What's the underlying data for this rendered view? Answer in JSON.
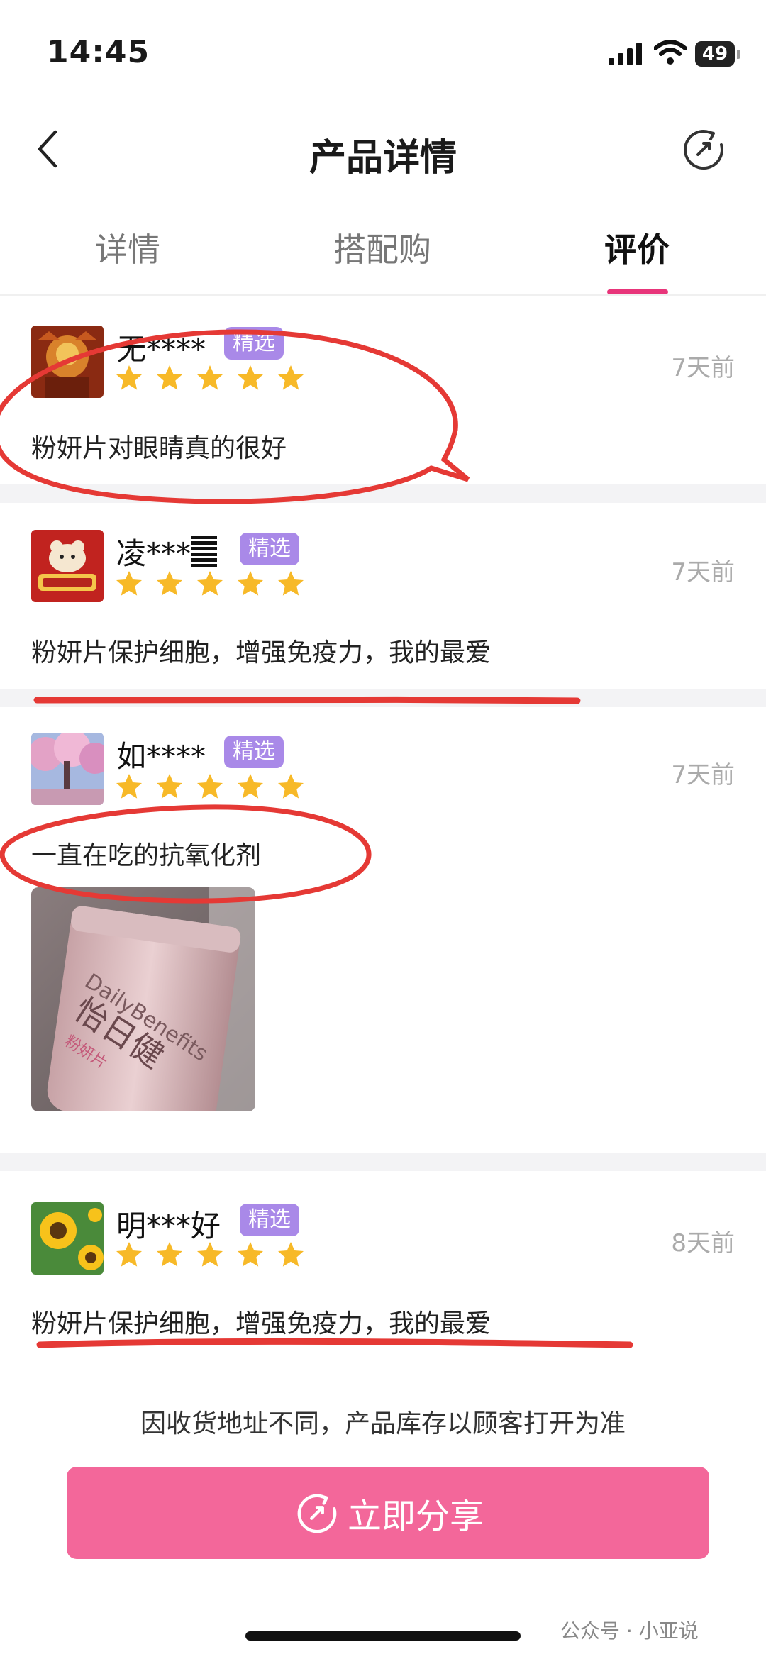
{
  "status_bar": {
    "time": "14:45",
    "battery": "49"
  },
  "nav": {
    "title": "产品详情"
  },
  "tabs": [
    {
      "label": "详情",
      "active": false
    },
    {
      "label": "搭配购",
      "active": false
    },
    {
      "label": "评价",
      "active": true
    }
  ],
  "reviews": [
    {
      "user": "无****",
      "badge": "精选",
      "rating": 5,
      "date": "7天前",
      "text": "粉妍片对眼睛真的很好"
    },
    {
      "user": "凌***",
      "badge": "精选",
      "rating": 5,
      "date": "7天前",
      "text": "粉妍片保护细胞，增强免疫力，我的最爱"
    },
    {
      "user": "如****",
      "badge": "精选",
      "rating": 5,
      "date": "7天前",
      "text": "一直在吃的抗氧化剂",
      "photo_text": [
        "DailyBenefits",
        "怡日健",
        "粉妍片"
      ]
    },
    {
      "user": "明***好",
      "badge": "精选",
      "rating": 5,
      "date": "8天前",
      "text": "粉妍片保护细胞，增强免疫力，我的最爱"
    }
  ],
  "bottom": {
    "notice": "因收货地址不同，产品库存以顾客打开为准",
    "share_label": "立即分享"
  },
  "watermark": "公众号 · 小亚说",
  "colors": {
    "accent": "#e8357a",
    "badge": "#a989e8",
    "star": "#f7b928",
    "share_button": "#f3679a",
    "annotation": "#e53935"
  }
}
